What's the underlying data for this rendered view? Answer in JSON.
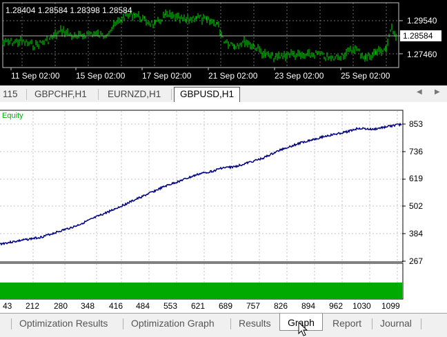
{
  "price_chart": {
    "ohlc_text": "1.28404 1.28584 1.28398 1.28584",
    "current_price": "1.28584",
    "y_labels": [
      "1.29540",
      "1.27460"
    ],
    "x_labels": [
      "11 Sep 02:00",
      "15 Sep 02:00",
      "17 Sep 02:00",
      "21 Sep 02:00",
      "23 Sep 02:00",
      "25 Sep 02:00"
    ],
    "line_color": "#00c000"
  },
  "symbol_tabs": {
    "items": [
      "115",
      "GBPCHF,H1",
      "EURNZD,H1",
      "GBPUSD,H1"
    ],
    "active": "GBPUSD,H1",
    "scroll_left": "◀",
    "scroll_right": "▶"
  },
  "equity_chart": {
    "label": "Equity",
    "line_color": "#000080",
    "bar_color": "#00aa00",
    "y_labels": [
      "853",
      "736",
      "619",
      "502",
      "384",
      "267"
    ],
    "x_labels": [
      "43",
      "212",
      "280",
      "348",
      "416",
      "484",
      "553",
      "621",
      "689",
      "757",
      "826",
      "894",
      "962",
      "1030",
      "1099"
    ]
  },
  "bottom_tabs": {
    "items": [
      "Optimization Results",
      "Optimization Graph",
      "Results",
      "Graph",
      "Report",
      "Journal"
    ],
    "active": "Graph"
  }
}
